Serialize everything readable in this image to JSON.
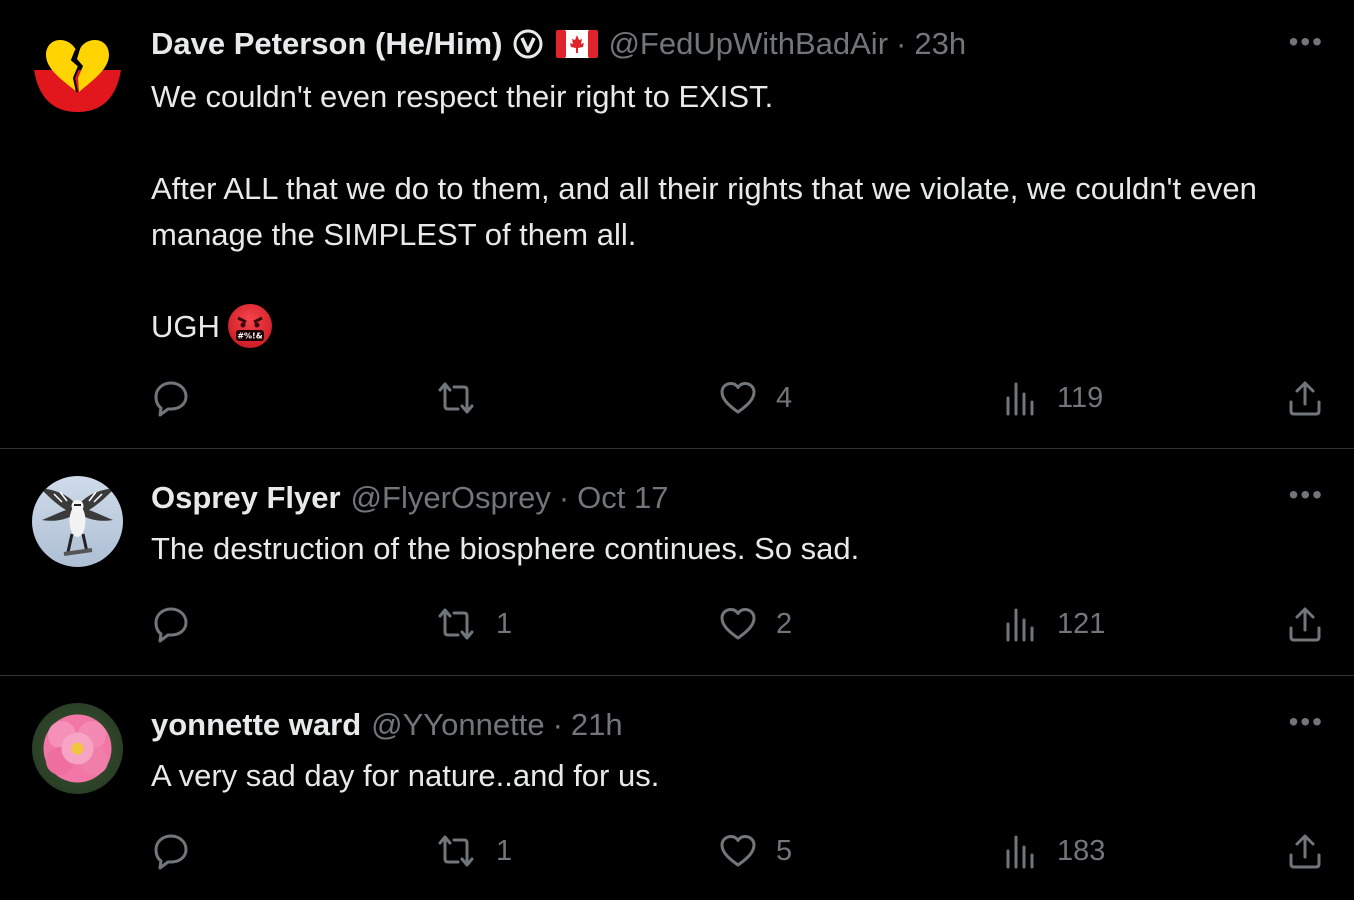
{
  "tweets": [
    {
      "name": "Dave Peterson (He/Him)",
      "handle": "@FedUpWithBadAir",
      "time": "23h",
      "body": "We couldn't even respect their right to EXIST.\n\nAfter ALL that we do to them, and all their rights that we violate, we couldn't even manage the SIMPLEST of them all.\n\nUGH",
      "emoji_text": "#%!&",
      "avatar_icon": "broken-heart-icon",
      "replies": "",
      "retweets": "",
      "likes": "4",
      "views": "119"
    },
    {
      "name": "Osprey Flyer",
      "handle": "@FlyerOsprey",
      "time": "Oct 17",
      "body": "The destruction of the biosphere continues. So sad.",
      "avatar_icon": "osprey-bird-avatar",
      "replies": "",
      "retweets": "1",
      "likes": "2",
      "views": "121"
    },
    {
      "name": "yonnette ward",
      "handle": "@YYonnette",
      "time": "21h",
      "body": "A very sad day for nature..and for us.",
      "avatar_icon": "pink-rose-avatar",
      "replies": "",
      "retweets": "1",
      "likes": "5",
      "views": "183"
    }
  ],
  "separator": "·",
  "more_label": "•••",
  "colors": {
    "background": "#000000",
    "text": "#e7e9ea",
    "muted": "#71767b",
    "divider": "#2f3336"
  }
}
